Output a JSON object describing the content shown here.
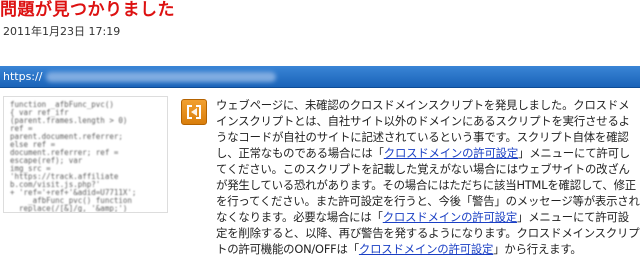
{
  "page": {
    "title": "問題が見つかりました",
    "date": "2011年1月23日 17:19"
  },
  "url_bar": {
    "url_prefix": "https://"
  },
  "code_thumbnail": {
    "code": "function _afbFunc_pvc()\n{ var ref_ifr\n(parent.frames.length > 0)\nref =\nparent.document.referrer;\nelse ref =\ndocument.referrer; ref =\nescape(ref); var\nimg_src =\n'https://track.affiliate\nb.com/visit.js.php?'\n+ 'ref='+ref+'&adid=U7711X';\n    _afbFunc_pvc() function\n  replace(/[&]/g, '&amp;')\n  str.replace(/[<]/g, '&lt;')\n  str.replace(/[>]/g, '')\n  return str; }"
  },
  "message": {
    "icon": "cross-domain-script-icon",
    "intro": "ウェブページに、未確認のクロスドメインスクリプトを発見しました。クロスドメインスクリプトとは、自社サイト以外のドメインにあるスクリプトを実行させるようなコードが自社のサイトに記述されているという事です。スクリプト自体を確認し、正常なものである場合には「",
    "link1": "クロスドメインの許可設定",
    "part2": "」メニューにて許可してください。このスクリプトを記載した覚えがない場合にはウェブサイトの改ざんが発生している恐れがあります。その場合にはただちに該当HTMLを確認して、修正を行ってください。また許可設定を行うと、今後「警告」のメッセージ等が表示されなくなります。必要な場合には「",
    "link2": "クロスドメインの許可設定",
    "part3": "」メニューにて許可設定を削除すると、以降、再び警告を発するようになります。クロスドメインスクリプトの許可機能のON/OFFは「",
    "link3": "クロスドメインの許可設定",
    "part4": "」から行えます。"
  },
  "colors": {
    "title": "#dd1111",
    "url_bar": "#1a63b8",
    "icon": "#e88a18",
    "link": "#1a3fc4"
  }
}
